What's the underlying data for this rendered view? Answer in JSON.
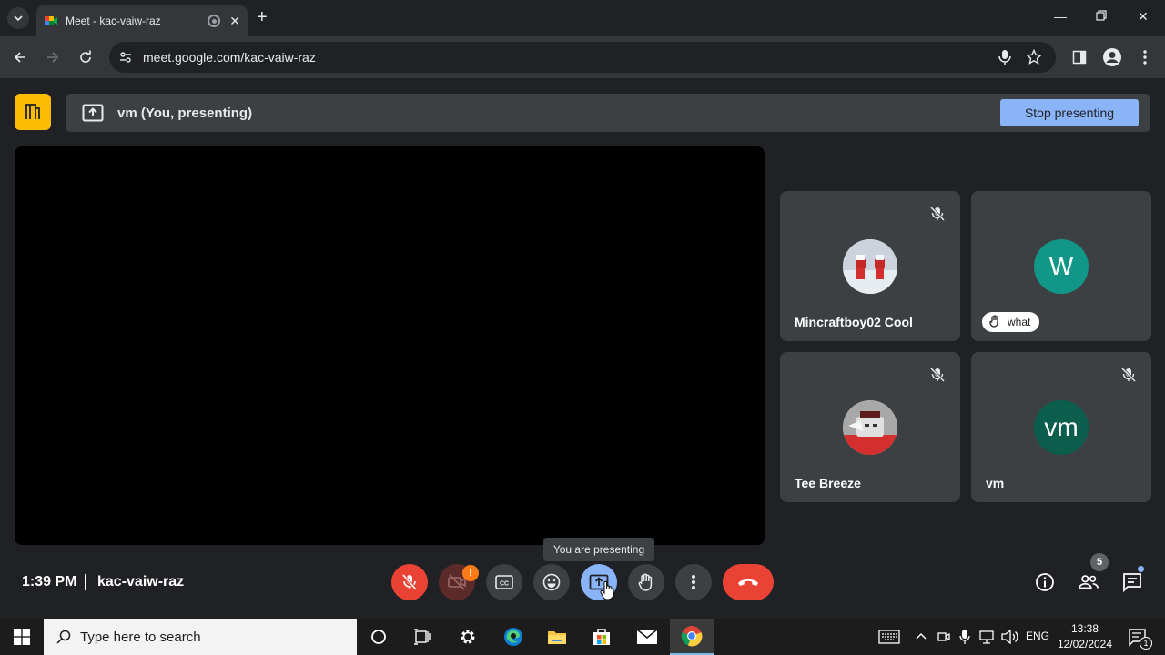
{
  "browser": {
    "tab_title": "Meet - kac-vaiw-raz",
    "url": "meet.google.com/kac-vaiw-raz"
  },
  "meet": {
    "presenter_label": "vm (You, presenting)",
    "stop_presenting_label": "Stop presenting",
    "tooltip": "You are presenting",
    "time": "1:39 PM",
    "meeting_code": "kac-vaiw-raz",
    "camera_warning": "!",
    "participant_count": "5",
    "participants": [
      {
        "name": "Mincraftboy02 Cool",
        "avatar": "image",
        "muted": true
      },
      {
        "name": "what",
        "initial": "W",
        "avatar_color": "#129688",
        "muted": false,
        "hand_raised": true
      },
      {
        "name": "Tee Breeze",
        "avatar": "image",
        "muted": true
      },
      {
        "name": "vm",
        "initial": "vm",
        "avatar_color": "#0b5e4c",
        "muted": true
      }
    ]
  },
  "taskbar": {
    "search_placeholder": "Type here to search",
    "language": "ENG",
    "time": "13:38",
    "date": "12/02/2024",
    "notification_count": "1"
  },
  "colors": {
    "accent": "#8ab4f8",
    "end_call": "#ea4335",
    "meet_logo": "#fbbc04"
  }
}
